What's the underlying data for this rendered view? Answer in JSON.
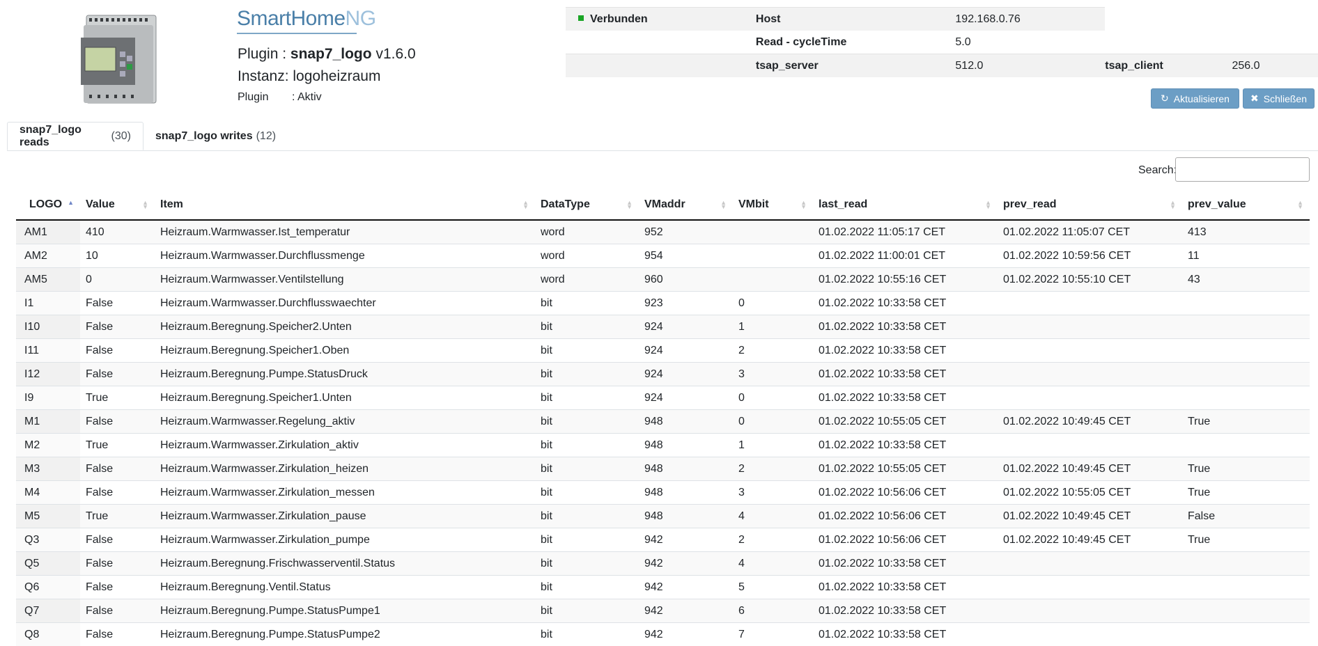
{
  "header": {
    "brand_main": "SmartHome",
    "brand_accent": "NG",
    "plugin_label": "Plugin :",
    "plugin_name": "snap7_logo",
    "plugin_version": "v1.6.0",
    "instanz_label": "Instanz:",
    "instanz_value": "logoheizraum",
    "status_label": "Plugin",
    "status_value": ": Aktiv"
  },
  "info": {
    "connection_status": "Verbunden",
    "connection_color": "#1aa526",
    "host_label": "Host",
    "host_value": "192.168.0.76",
    "cycle_label": "Read - cycleTime",
    "cycle_value": "5.0",
    "tsap_server_label": "tsap_server",
    "tsap_server_value": "512.0",
    "tsap_client_label": "tsap_client",
    "tsap_client_value": "256.0"
  },
  "buttons": {
    "refresh_label": "Aktualisieren",
    "refresh_icon": "refresh-icon",
    "close_label": "Schließen",
    "close_icon": "close-icon",
    "button_color": "#6c9ec5"
  },
  "tabs": [
    {
      "label": "snap7_logo reads",
      "count": "(30)"
    },
    {
      "label": "snap7_logo writes",
      "count": "(12)"
    }
  ],
  "search": {
    "label": "Search:",
    "value": ""
  },
  "table": {
    "columns": [
      "LOGO",
      "Value",
      "Item",
      "DataType",
      "VMaddr",
      "VMbit",
      "last_read",
      "prev_read",
      "prev_value"
    ],
    "rows": [
      [
        "AM1",
        "410",
        "Heizraum.Warmwasser.Ist_temperatur",
        "word",
        "952",
        "",
        "01.02.2022 11:05:17 CET",
        "01.02.2022 11:05:07 CET",
        "413"
      ],
      [
        "AM2",
        "10",
        "Heizraum.Warmwasser.Durchflussmenge",
        "word",
        "954",
        "",
        "01.02.2022 11:00:01 CET",
        "01.02.2022 10:59:56 CET",
        "11"
      ],
      [
        "AM5",
        "0",
        "Heizraum.Warmwasser.Ventilstellung",
        "word",
        "960",
        "",
        "01.02.2022 10:55:16 CET",
        "01.02.2022 10:55:10 CET",
        "43"
      ],
      [
        "I1",
        "False",
        "Heizraum.Warmwasser.Durchflusswaechter",
        "bit",
        "923",
        "0",
        "01.02.2022 10:33:58 CET",
        "",
        ""
      ],
      [
        "I10",
        "False",
        "Heizraum.Beregnung.Speicher2.Unten",
        "bit",
        "924",
        "1",
        "01.02.2022 10:33:58 CET",
        "",
        ""
      ],
      [
        "I11",
        "False",
        "Heizraum.Beregnung.Speicher1.Oben",
        "bit",
        "924",
        "2",
        "01.02.2022 10:33:58 CET",
        "",
        ""
      ],
      [
        "I12",
        "False",
        "Heizraum.Beregnung.Pumpe.StatusDruck",
        "bit",
        "924",
        "3",
        "01.02.2022 10:33:58 CET",
        "",
        ""
      ],
      [
        "I9",
        "True",
        "Heizraum.Beregnung.Speicher1.Unten",
        "bit",
        "924",
        "0",
        "01.02.2022 10:33:58 CET",
        "",
        ""
      ],
      [
        "M1",
        "False",
        "Heizraum.Warmwasser.Regelung_aktiv",
        "bit",
        "948",
        "0",
        "01.02.2022 10:55:05 CET",
        "01.02.2022 10:49:45 CET",
        "True"
      ],
      [
        "M2",
        "True",
        "Heizraum.Warmwasser.Zirkulation_aktiv",
        "bit",
        "948",
        "1",
        "01.02.2022 10:33:58 CET",
        "",
        ""
      ],
      [
        "M3",
        "False",
        "Heizraum.Warmwasser.Zirkulation_heizen",
        "bit",
        "948",
        "2",
        "01.02.2022 10:55:05 CET",
        "01.02.2022 10:49:45 CET",
        "True"
      ],
      [
        "M4",
        "False",
        "Heizraum.Warmwasser.Zirkulation_messen",
        "bit",
        "948",
        "3",
        "01.02.2022 10:56:06 CET",
        "01.02.2022 10:55:05 CET",
        "True"
      ],
      [
        "M5",
        "True",
        "Heizraum.Warmwasser.Zirkulation_pause",
        "bit",
        "948",
        "4",
        "01.02.2022 10:56:06 CET",
        "01.02.2022 10:49:45 CET",
        "False"
      ],
      [
        "Q3",
        "False",
        "Heizraum.Warmwasser.Zirkulation_pumpe",
        "bit",
        "942",
        "2",
        "01.02.2022 10:56:06 CET",
        "01.02.2022 10:49:45 CET",
        "True"
      ],
      [
        "Q5",
        "False",
        "Heizraum.Beregnung.Frischwasserventil.Status",
        "bit",
        "942",
        "4",
        "01.02.2022 10:33:58 CET",
        "",
        ""
      ],
      [
        "Q6",
        "False",
        "Heizraum.Beregnung.Ventil.Status",
        "bit",
        "942",
        "5",
        "01.02.2022 10:33:58 CET",
        "",
        ""
      ],
      [
        "Q7",
        "False",
        "Heizraum.Beregnung.Pumpe.StatusPumpe1",
        "bit",
        "942",
        "6",
        "01.02.2022 10:33:58 CET",
        "",
        ""
      ],
      [
        "Q8",
        "False",
        "Heizraum.Beregnung.Pumpe.StatusPumpe2",
        "bit",
        "942",
        "7",
        "01.02.2022 10:33:58 CET",
        "",
        ""
      ]
    ]
  }
}
